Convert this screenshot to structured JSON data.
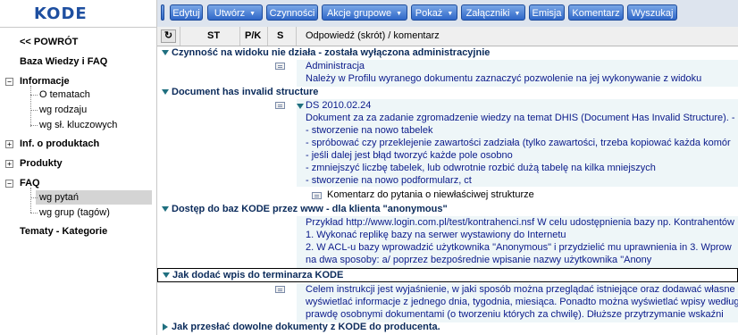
{
  "app": {
    "logo": "KODE"
  },
  "sidebar": {
    "back": "<< POWRÓT",
    "kb": "Baza Wiedzy i FAQ",
    "informacje": "Informacje",
    "informacje_items": [
      "O tematach",
      "wg rodzaju",
      "wg sł. kluczowych"
    ],
    "inf_produkt": "Inf. o produktach",
    "produkty": "Produkty",
    "faq": "FAQ",
    "faq_items": [
      "wg pytań",
      "wg grup (tagów)"
    ],
    "tematy": "Tematy - Kategorie"
  },
  "toolbar": {
    "edytuj": "Edytuj",
    "utworz": "Utwórz",
    "czynnosci": "Czynności",
    "akcje": "Akcje grupowe",
    "pokaz": "Pokaż",
    "zalaczniki": "Załączniki",
    "emisja": "Emisja",
    "komentarz": "Komentarz",
    "wyszukaj": "Wyszukaj"
  },
  "columns": {
    "st": "ST",
    "pk": "P/K",
    "s": "S",
    "odp": "Odpowiedź (skrót) / komentarz"
  },
  "content": {
    "cat1": "Czynność na widoku nie działa - została wyłączona administracyjnie",
    "cat1_lines": [
      "Administracja",
      "Należy w Profilu wyranego dokumentu zaznaczyć pozwolenie na jej wykonywanie z widoku"
    ],
    "cat2": "Document has invalid structure",
    "cat2_lines": [
      "DS 2010.02.24",
      "Dokument za za zadanie zgromadzenie wiedzy na temat DHIS (Document Has Invalid Structure). - do",
      "- stworzenie na nowo tabelek",
      "- spróbować czy przeklejenie zawartości zadziała (tylko zawartości, trzeba kopiować każda komór",
      "- jeśli dalej jest błąd tworzyć każde pole osobno",
      "- zmniejszyć liczbę tabelek, lub odwrotnie rozbić dużą tabelę na kilka mniejszych",
      "- stworzenie na nowo podformularz, ct"
    ],
    "cat2_comment": "Komentarz do pytania o niewłaściwej strukturze",
    "cat3": "Dostęp do baz KODE przez www - dla klienta \"anonymous\"",
    "cat3_lines": [
      "Przykład http://www.login.com.pl/test/kontrahenci.nsf W celu udostępnienia bazy np. Kontrahentów",
      "1. Wykonać replikę bazy na serwer wystawiony do Internetu",
      "2. W ACL-u bazy wprowadzić użytkownika \"Anonymous\" i przydzielić mu uprawnienia in 3. Wprow",
      "na dwa sposoby: a/ poprzez bezpośrednie wpisanie nazwy użytkownika \"Anony"
    ],
    "cat4": "Jak dodać wpis do terminarza KODE",
    "cat4_lines": [
      "Celem instrukcji jest wyjaśnienie, w jaki sposób można przeglądać istniejące oraz dodawać własne",
      "wyświetlać informacje z jednego dnia, tygodnia, miesiąca. Ponadto można wyświetlać wpisy według",
      "prawdę osobnymi dokumentami (o tworzeniu których za chwilę). Dłuższe przytrzymanie wskaźni"
    ],
    "cat5": "Jak przesłać dowolne dokumenty z KODE do producenta."
  }
}
